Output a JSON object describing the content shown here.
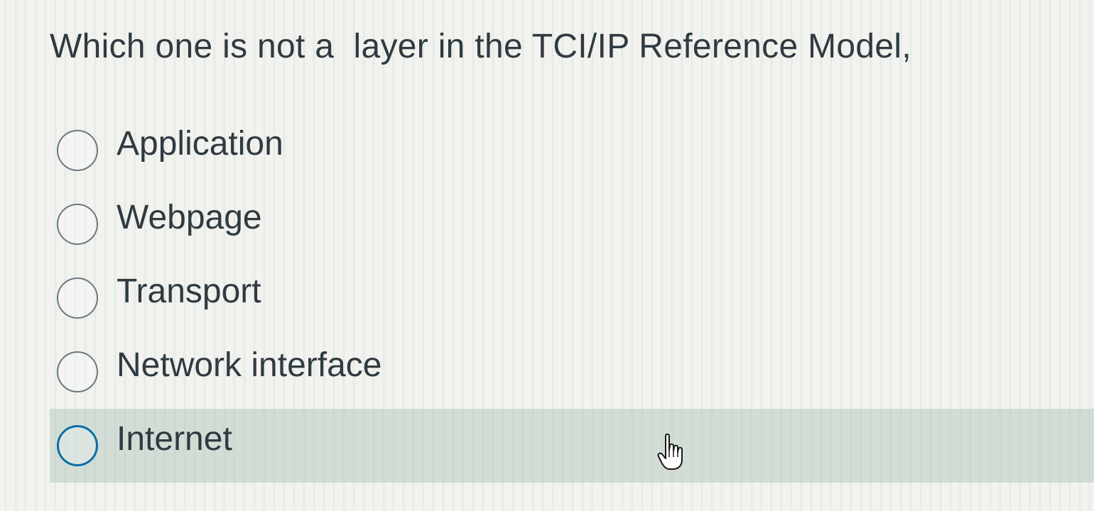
{
  "question": {
    "text": "Which one is not a  layer in the TCI/IP Reference Model,"
  },
  "answers": [
    {
      "label": "Application",
      "selected": false
    },
    {
      "label": "Webpage",
      "selected": false
    },
    {
      "label": "Transport",
      "selected": false
    },
    {
      "label": "Network interface",
      "selected": false
    },
    {
      "label": "Internet",
      "selected": false,
      "hovered": true
    }
  ],
  "colors": {
    "radio_border": "#6b7780",
    "radio_hover_border": "#0b6ea8",
    "hover_row_background": "#aac3b9",
    "text": "#2f3a42"
  },
  "cursor": {
    "icon": "pointer-hand-icon"
  }
}
